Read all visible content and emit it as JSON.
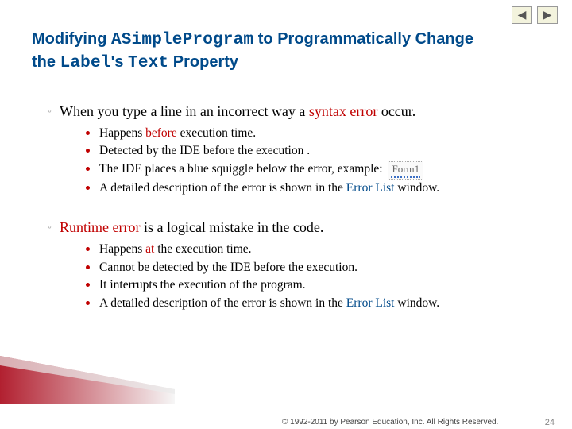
{
  "nav": {
    "prev_icon": "◀",
    "next_icon": "▶"
  },
  "title": {
    "p1": "Modifying ",
    "code1": "ASimpleProgram",
    "p2": " to Programmatically Change the ",
    "code2": "Label",
    "p3": "'s ",
    "code3": "Text",
    "p4": " Property"
  },
  "sections": [
    {
      "main": {
        "pre": "When you type a line in an incorrect way a ",
        "hl": "syntax error",
        "post": " occur."
      },
      "items": [
        {
          "pre": "Happens ",
          "hl": "before",
          "post": " execution time."
        },
        {
          "text": "Detected by the IDE before the execution ."
        },
        {
          "pre": "The IDE places a blue squiggle below the error, example: ",
          "squiggle": "Form1"
        },
        {
          "pre": "A detailed description of the error is shown in the ",
          "link": "Error List",
          "post": " window."
        }
      ]
    },
    {
      "main": {
        "hl": "Runtime error",
        "post": "  is a logical mistake in the code."
      },
      "items": [
        {
          "pre": "Happens ",
          "hl": "at",
          "post": " the execution time."
        },
        {
          "text": "Cannot be detected by the IDE before the execution."
        },
        {
          "text": "It interrupts the execution of the program."
        },
        {
          "pre": "A detailed description of the error is shown in the ",
          "link": "Error List",
          "post": " window."
        }
      ]
    }
  ],
  "footer": {
    "copyright": "© 1992-2011 by Pearson Education, Inc. All Rights Reserved.",
    "page": "24"
  }
}
